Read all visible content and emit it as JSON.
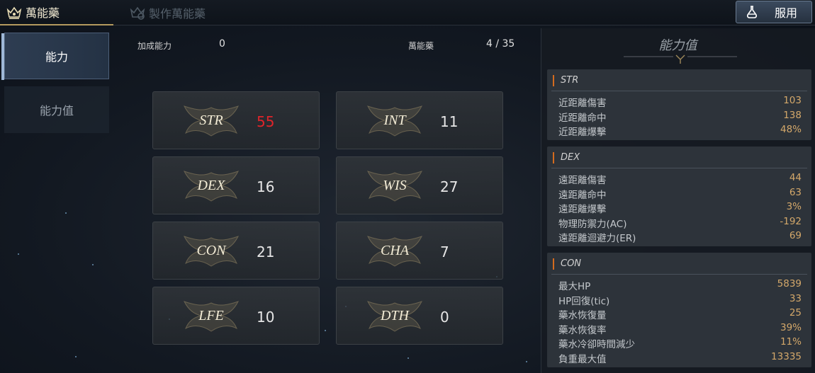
{
  "top_tabs": [
    {
      "label": "萬能藥",
      "active": true
    },
    {
      "label": "製作萬能藥",
      "active": false
    }
  ],
  "use_button": {
    "label": "服用"
  },
  "nav": [
    {
      "label": "能力",
      "active": true
    },
    {
      "label": "能力值",
      "active": false
    }
  ],
  "header": {
    "bonus_label": "加成能力",
    "bonus_value": "0",
    "elixir_label": "萬能藥",
    "elixir_count": "4 / 35"
  },
  "stats": [
    {
      "name": "STR",
      "value": "55",
      "highlight": true
    },
    {
      "name": "INT",
      "value": "11",
      "highlight": false
    },
    {
      "name": "DEX",
      "value": "16",
      "highlight": false
    },
    {
      "name": "WIS",
      "value": "27",
      "highlight": false
    },
    {
      "name": "CON",
      "value": "21",
      "highlight": false
    },
    {
      "name": "CHA",
      "value": "7",
      "highlight": false
    },
    {
      "name": "LFE",
      "value": "10",
      "highlight": false
    },
    {
      "name": "DTH",
      "value": "0",
      "highlight": false
    }
  ],
  "panel": {
    "title": "能力值",
    "groups": [
      {
        "name": "STR",
        "rows": [
          {
            "label": "近距離傷害",
            "value": "103"
          },
          {
            "label": "近距離命中",
            "value": "138"
          },
          {
            "label": "近距離爆擊",
            "value": "48%"
          }
        ]
      },
      {
        "name": "DEX",
        "rows": [
          {
            "label": "遠距離傷害",
            "value": "44"
          },
          {
            "label": "遠距離命中",
            "value": "63"
          },
          {
            "label": "遠距離爆擊",
            "value": "3%"
          },
          {
            "label": "物理防禦力(AC)",
            "value": "-192"
          },
          {
            "label": "遠距離迴避力(ER)",
            "value": "69"
          }
        ]
      },
      {
        "name": "CON",
        "rows": [
          {
            "label": "最大HP",
            "value": "5839"
          },
          {
            "label": "HP回復(tic)",
            "value": "33"
          },
          {
            "label": "藥水恢復量",
            "value": "25"
          },
          {
            "label": "藥水恢復率",
            "value": "39%"
          },
          {
            "label": "藥水冷卻時間減少",
            "value": "11%"
          },
          {
            "label": "負重最大值",
            "value": "13335"
          }
        ]
      }
    ]
  },
  "colors": {
    "accent_gold": "#d4a86a",
    "highlight_red": "#e0242a",
    "group_marker": "#d46b1e"
  }
}
